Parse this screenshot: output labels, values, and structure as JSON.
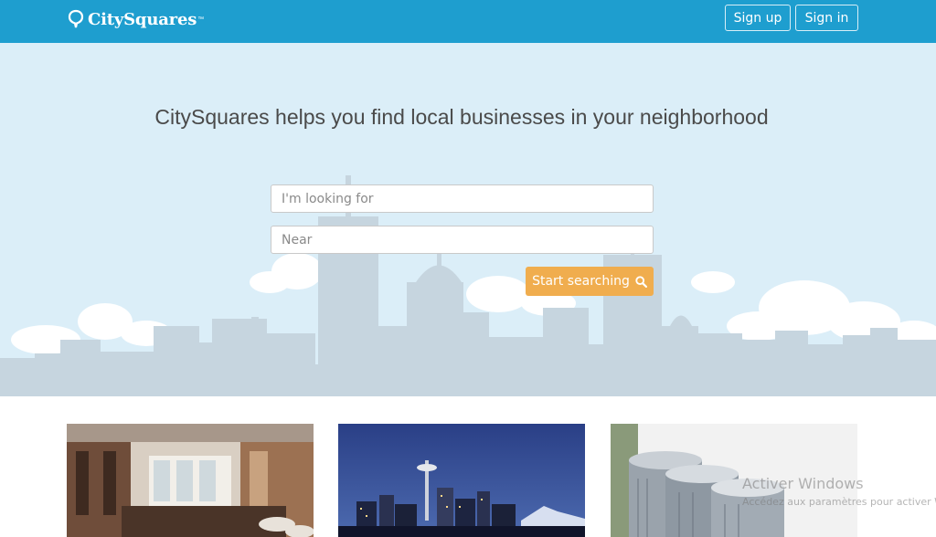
{
  "header": {
    "logo_text": "CitySquares",
    "logo_tm": "™",
    "signup_label": "Sign up",
    "signin_label": "Sign in",
    "bg_color": "#1e9ecf"
  },
  "hero": {
    "headline": "CitySquares helps you find local businesses in your neighborhood",
    "what_placeholder": "I'm looking for",
    "near_placeholder": "Near",
    "search_label": "Start searching",
    "search_icon": "search-icon",
    "button_color": "#f0ad4e"
  },
  "cards": [
    {
      "image": "salon-interior-photo"
    },
    {
      "image": "seattle-skyline-photo"
    },
    {
      "image": "air-conditioner-units-photo"
    }
  ],
  "watermark": {
    "title": "Activer Windows",
    "subtitle": "Accédez aux paramètres pour activer Windows."
  }
}
